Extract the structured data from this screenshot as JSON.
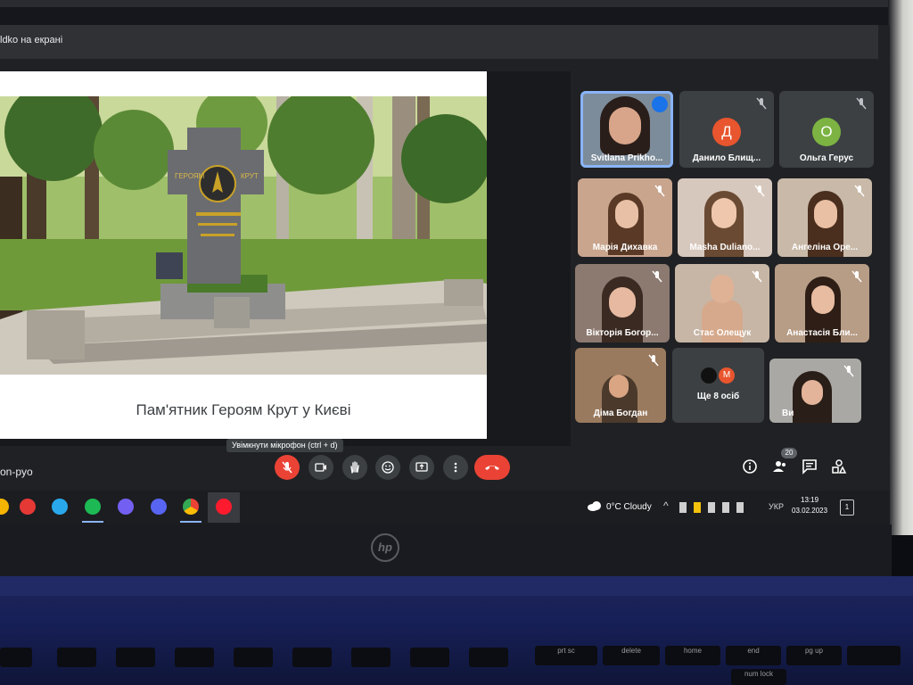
{
  "banner": {
    "text": "ldko на екрані"
  },
  "slide": {
    "caption": "Пам'ятник Героям Крут у Києві",
    "monument_text_left": "ГЕРОЯМ",
    "monument_text_right": "КРУТ"
  },
  "participants": [
    {
      "name": "Svitlana Prikho...",
      "type": "video",
      "active": true
    },
    {
      "name": "Данило Блищ...",
      "type": "avatar",
      "initial": "Д",
      "color": "#e8552e"
    },
    {
      "name": "Ольга Герус",
      "type": "avatar",
      "initial": "О",
      "color": "#7cb342"
    },
    {
      "name": "Марія Дихавка",
      "type": "video"
    },
    {
      "name": "Masha Duliano...",
      "type": "video"
    },
    {
      "name": "Ангеліна Оре...",
      "type": "video"
    },
    {
      "name": "Вікторія Богор...",
      "type": "video"
    },
    {
      "name": "Стас Олещук",
      "type": "video"
    },
    {
      "name": "Анастасія Бли...",
      "type": "video"
    },
    {
      "name": "Діма Богдан",
      "type": "video"
    },
    {
      "name": "Ще 8 осіб",
      "type": "more",
      "initial": "М"
    },
    {
      "name": "Ви",
      "type": "video"
    }
  ],
  "controls": {
    "tooltip": "Увімкнути мікрофон (ctrl + d)",
    "meeting_code": "on-pyo",
    "people_count": "20"
  },
  "taskbar": {
    "weather": "0°C  Cloudy",
    "language": "УКР",
    "time": "13:19",
    "date": "03.02.2023",
    "notifications": "1"
  },
  "keyboard": [
    "prt sc",
    "delete",
    "home",
    "end",
    "pg up",
    "num lock"
  ]
}
